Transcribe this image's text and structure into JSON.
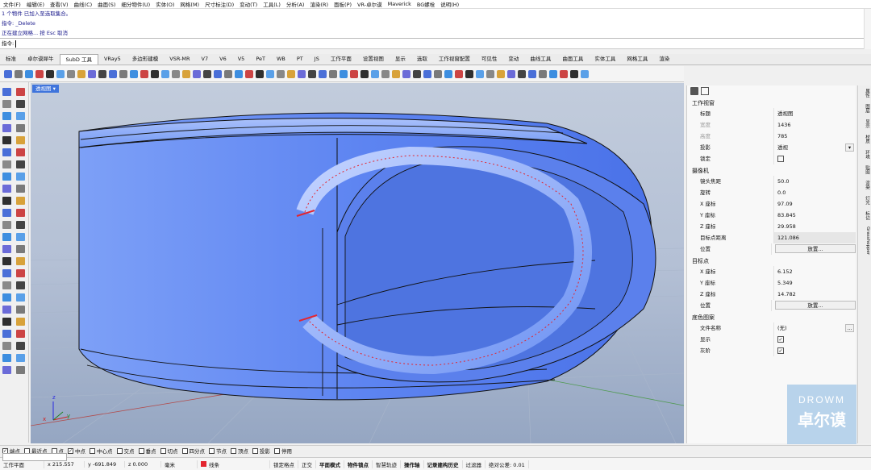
{
  "menu": [
    "文件(F)",
    "编辑(E)",
    "查看(V)",
    "曲线(C)",
    "曲面(S)",
    "细分物件(U)",
    "实体(O)",
    "网格(M)",
    "尺寸标注(D)",
    "变动(T)",
    "工具(L)",
    "分析(A)",
    "渲染(R)",
    "面板(P)",
    "VR-卓尔谟",
    "Maverick",
    "BG螺栓",
    "说明(H)"
  ],
  "command": {
    "history": [
      "1 个物件 已加入至选取集合。",
      "指令: _Delete",
      "正在建立网格... 按 Esc 取消"
    ],
    "prompt": "指令:"
  },
  "tabs": [
    "标准",
    "卓尔谟犀牛",
    "SubD 工具",
    "VRay5",
    "多边形建模",
    "VSR-MR",
    "V7",
    "V6",
    "V5",
    "PeT",
    "WB",
    "PT",
    "JS",
    "工作平面",
    "设置视图",
    "显示",
    "选取",
    "工作视窗配置",
    "可见性",
    "变动",
    "曲线工具",
    "曲面工具",
    "实体工具",
    "网格工具",
    "渲染"
  ],
  "active_tab": "SubD 工具",
  "viewport": {
    "label": "透视图",
    "dropdown": "▾"
  },
  "panel": {
    "sections": {
      "viewport": "工作视窗",
      "camera": "摄像机",
      "target": "目标点",
      "wallpaper": "底色图案"
    },
    "viewport_rows": [
      {
        "k": "标题",
        "v": "透视图"
      },
      {
        "k": "宽度",
        "v": "1436"
      },
      {
        "k": "高度",
        "v": "785"
      },
      {
        "k": "投影",
        "v": "透视"
      },
      {
        "k": "锁定",
        "v": ""
      }
    ],
    "camera_rows": [
      {
        "k": "镜头焦距",
        "v": "50.0"
      },
      {
        "k": "旋转",
        "v": "0.0"
      },
      {
        "k": "X 座标",
        "v": "97.09"
      },
      {
        "k": "Y 座标",
        "v": "83.845"
      },
      {
        "k": "Z 座标",
        "v": "29.958"
      },
      {
        "k": "目标点距离",
        "v": "121.086"
      },
      {
        "k": "位置",
        "v": "放置..."
      }
    ],
    "target_rows": [
      {
        "k": "X 座标",
        "v": "6.152"
      },
      {
        "k": "Y 座标",
        "v": "5.349"
      },
      {
        "k": "Z 座标",
        "v": "14.782"
      },
      {
        "k": "位置",
        "v": "放置..."
      }
    ],
    "wallpaper_rows": [
      {
        "k": "文件名称",
        "v": "(无)"
      },
      {
        "k": "显示",
        "v": "✓"
      },
      {
        "k": "灰阶",
        "v": "✓"
      }
    ],
    "ellipsis": "..."
  },
  "right_tabs": [
    "属性",
    "图层",
    "显示",
    "材质",
    "环境",
    "贴图",
    "渲染",
    "灯光",
    "标记",
    "Grasshopper"
  ],
  "osnap": [
    {
      "label": "端点",
      "on": true
    },
    {
      "label": "最近点",
      "on": false
    },
    {
      "label": "点",
      "on": false
    },
    {
      "label": "中点",
      "on": true
    },
    {
      "label": "中心点",
      "on": false
    },
    {
      "label": "交点",
      "on": false
    },
    {
      "label": "垂点",
      "on": false
    },
    {
      "label": "切点",
      "on": false
    },
    {
      "label": "四分点",
      "on": false
    },
    {
      "label": "节点",
      "on": false
    },
    {
      "label": "顶点",
      "on": false
    },
    {
      "label": "投影",
      "on": false
    },
    {
      "label": "停用",
      "on": false
    }
  ],
  "status": {
    "cplane": "工作平面",
    "x": "x 215.557",
    "y": "y -691.849",
    "z": "z 0.000",
    "unit": "毫米",
    "layer": "线条",
    "items": [
      "锁定格点",
      "正交",
      "平面模式",
      "物件锁点",
      "智慧轨迹",
      "操作轴",
      "记录建构历史",
      "过滤器",
      "绝对公差: 0.01"
    ]
  },
  "axes": {
    "x": "x",
    "y": "y",
    "z": "z"
  },
  "watermark": {
    "line1": "DROWM",
    "line2": "卓尔谟"
  },
  "colors": {
    "viewport_bg": "#aab8cf",
    "model": "#5e86f2",
    "accent": "#3f74dc",
    "red_edge": "#e3252f"
  }
}
